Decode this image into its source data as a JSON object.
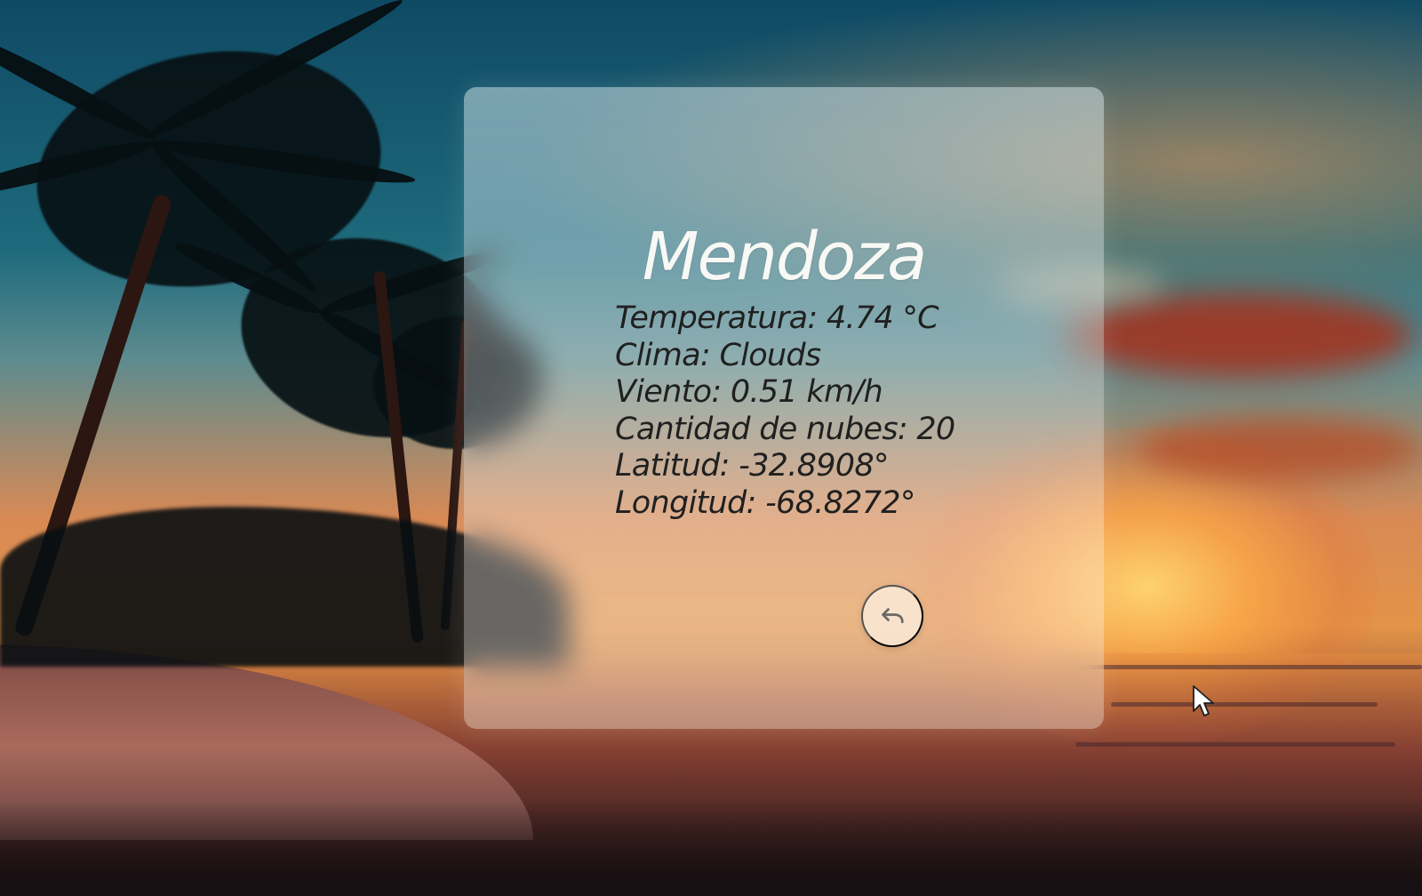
{
  "weather_card": {
    "city": "Mendoza",
    "details": [
      "Temperatura: 4.74 °C",
      "Clima: Clouds",
      "Viento: 0.51 km/h",
      "Cantidad de nubes: 20",
      "Latitud: -32.8908°",
      "Longitud: -68.8272°"
    ],
    "back_icon": "undo-arrow-icon"
  },
  "cursor": {
    "icon": "mouse-pointer-icon"
  }
}
